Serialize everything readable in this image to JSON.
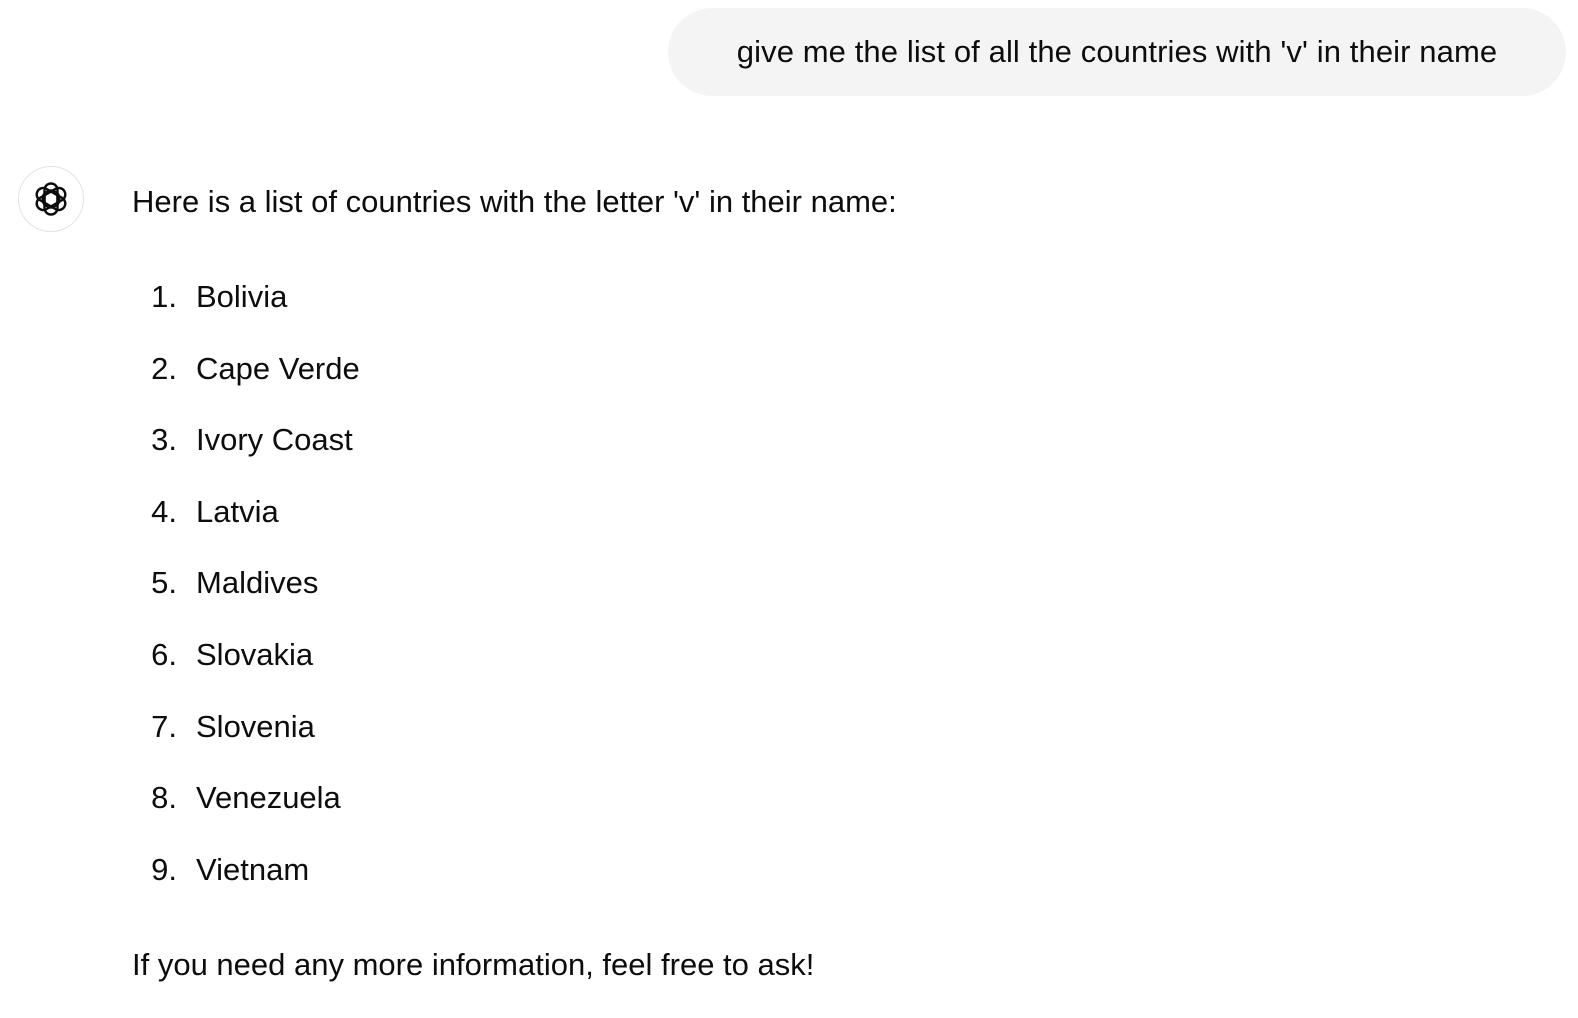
{
  "user_message": {
    "text": "give me the list of all the countries with 'v' in their name"
  },
  "assistant": {
    "avatar_icon": "openai-logo-icon",
    "intro": "Here is a list of countries with the letter 'v' in their name:",
    "countries": [
      {
        "num": "1.",
        "name": "Bolivia"
      },
      {
        "num": "2.",
        "name": "Cape Verde"
      },
      {
        "num": "3.",
        "name": "Ivory Coast"
      },
      {
        "num": "4.",
        "name": "Latvia"
      },
      {
        "num": "5.",
        "name": "Maldives"
      },
      {
        "num": "6.",
        "name": "Slovakia"
      },
      {
        "num": "7.",
        "name": "Slovenia"
      },
      {
        "num": "8.",
        "name": "Venezuela"
      },
      {
        "num": "9.",
        "name": "Vietnam"
      }
    ],
    "outro": "If you need any more information, feel free to ask!"
  },
  "colors": {
    "bubble_background": "#f4f4f4",
    "text": "#0d0d0d",
    "avatar_border": "#e3e3e3"
  }
}
